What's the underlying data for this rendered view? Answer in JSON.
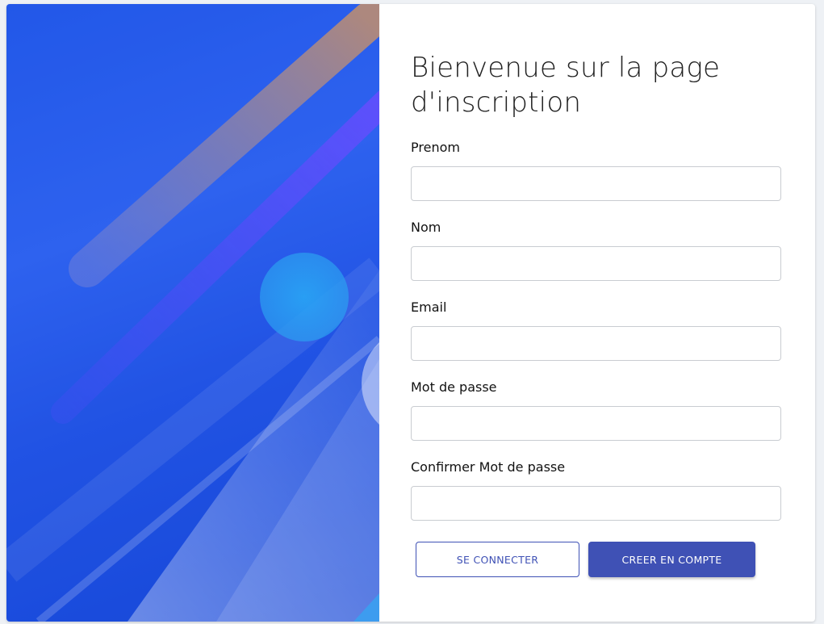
{
  "page": {
    "title": "Bienvenue sur la page d'inscription"
  },
  "form": {
    "fields": [
      {
        "label": "Prenom",
        "value": "",
        "placeholder": ""
      },
      {
        "label": "Nom",
        "value": "",
        "placeholder": ""
      },
      {
        "label": "Email",
        "value": "",
        "placeholder": ""
      },
      {
        "label": "Mot de passe",
        "value": "",
        "placeholder": ""
      },
      {
        "label": "Confirmer Mot de passe",
        "value": "",
        "placeholder": ""
      }
    ],
    "login_button": "SE CONNECTER",
    "create_button": "CREER EN COMPTE"
  },
  "colors": {
    "primary": "#3f51b5",
    "hero_blue": "#2f63ef"
  }
}
